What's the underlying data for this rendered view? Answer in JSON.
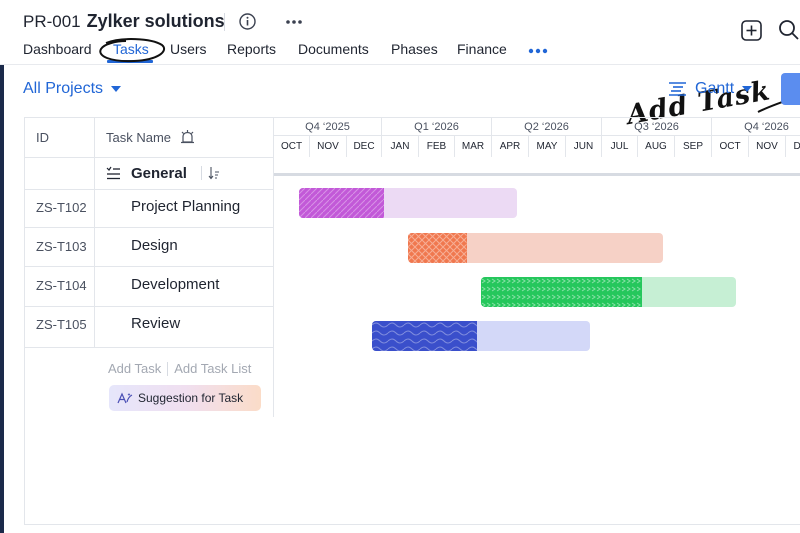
{
  "project": {
    "code": "PR-001",
    "name": "Zylker solutions"
  },
  "icons": {
    "info": "info-icon",
    "more": "more-icon",
    "add": "plus-square-icon",
    "search": "search-icon",
    "gantt": "gantt-icon",
    "caret": "chevron-down-icon",
    "reminder": "alarm-icon",
    "group": "list-collapse-icon",
    "sort": "sort-icon",
    "ai": "ai-sparkle-icon"
  },
  "nav": {
    "tabs": [
      {
        "label": "Dashboard"
      },
      {
        "label": "Tasks"
      },
      {
        "label": "Users"
      },
      {
        "label": "Reports"
      },
      {
        "label": "Documents"
      },
      {
        "label": "Phases"
      },
      {
        "label": "Finance"
      }
    ]
  },
  "annotation": {
    "text": "Add Task"
  },
  "toolbar": {
    "filter": "All Projects",
    "view": "Gantt"
  },
  "table": {
    "headers": {
      "id": "ID",
      "name": "Task Name"
    },
    "group": "General",
    "tasks": [
      {
        "id": "ZS-T102",
        "name": "Project Planning"
      },
      {
        "id": "ZS-T103",
        "name": "Design"
      },
      {
        "id": "ZS-T104",
        "name": "Development"
      },
      {
        "id": "ZS-T105",
        "name": "Review"
      }
    ],
    "add_task": "Add Task",
    "add_task_list": "Add Task List",
    "suggestion": "Suggestion for Task"
  },
  "gantt": {
    "quarters": [
      "Q4 ‘2025",
      "Q1 ‘2026",
      "Q2 ‘2026",
      "Q3 ‘2026",
      "Q4 ‘2026"
    ],
    "months": [
      "OCT",
      "NOV",
      "DEC",
      "JAN",
      "FEB",
      "MAR",
      "APR",
      "MAY",
      "JUN",
      "JUL",
      "AUG",
      "SEP",
      "OCT",
      "NOV",
      "DEC"
    ],
    "bars": [
      {
        "task": "ZS-T102",
        "start": "2025-10",
        "end": "2026-04",
        "progress": 0.39,
        "color": "#c259d8",
        "track": "#ecdaf4"
      },
      {
        "task": "ZS-T103",
        "start": "2026-01",
        "end": "2026-08",
        "progress": 0.23,
        "color": "#f0784f",
        "track": "#f6d1c6"
      },
      {
        "task": "ZS-T104",
        "start": "2026-03",
        "end": "2026-10",
        "progress": 0.63,
        "color": "#25c75c",
        "track": "#c6efd4"
      },
      {
        "task": "ZS-T105",
        "start": "2025-12",
        "end": "2026-06",
        "progress": 0.48,
        "color": "#3a4fcb",
        "track": "#d3d8f8"
      }
    ]
  }
}
